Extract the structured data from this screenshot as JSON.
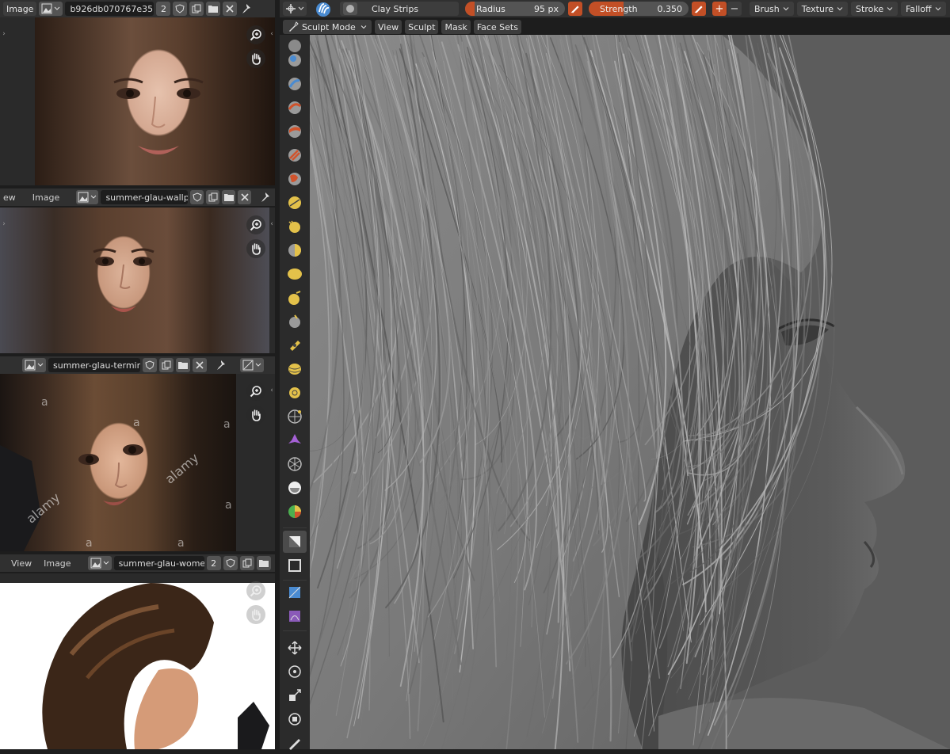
{
  "image_editors": [
    {
      "menus": [
        "Image"
      ],
      "image_name": "b926db070767e35...",
      "users": "2"
    },
    {
      "menus": [
        "ew",
        "Image"
      ],
      "image_name": "summer-glau-wallpa...",
      "users": ""
    },
    {
      "menus": [],
      "image_name": "summer-glau-termin...",
      "users": "",
      "watermark": "alamy",
      "watermark_letter": "a"
    },
    {
      "menus": [
        "View",
        "Image"
      ],
      "image_name": "summer-glau-wome...",
      "users": "2"
    }
  ],
  "viewport_header": {
    "brush_name": "Clay Strips",
    "radius_label": "Radius",
    "radius_value": "95 px",
    "strength_label": "Strength",
    "strength_value": "0.350",
    "strength_fraction": 0.35,
    "plus_label": "+",
    "minus_label": "−",
    "dropdowns": [
      "Brush",
      "Texture",
      "Stroke",
      "Falloff"
    ]
  },
  "viewport_subheader": {
    "mode": "Sculpt Mode",
    "menus": [
      "View",
      "Sculpt",
      "Mask",
      "Face Sets"
    ]
  },
  "colors": {
    "accent_orange": "#c24f26",
    "active_tool": "#4772b3",
    "header_bg": "#303030"
  }
}
